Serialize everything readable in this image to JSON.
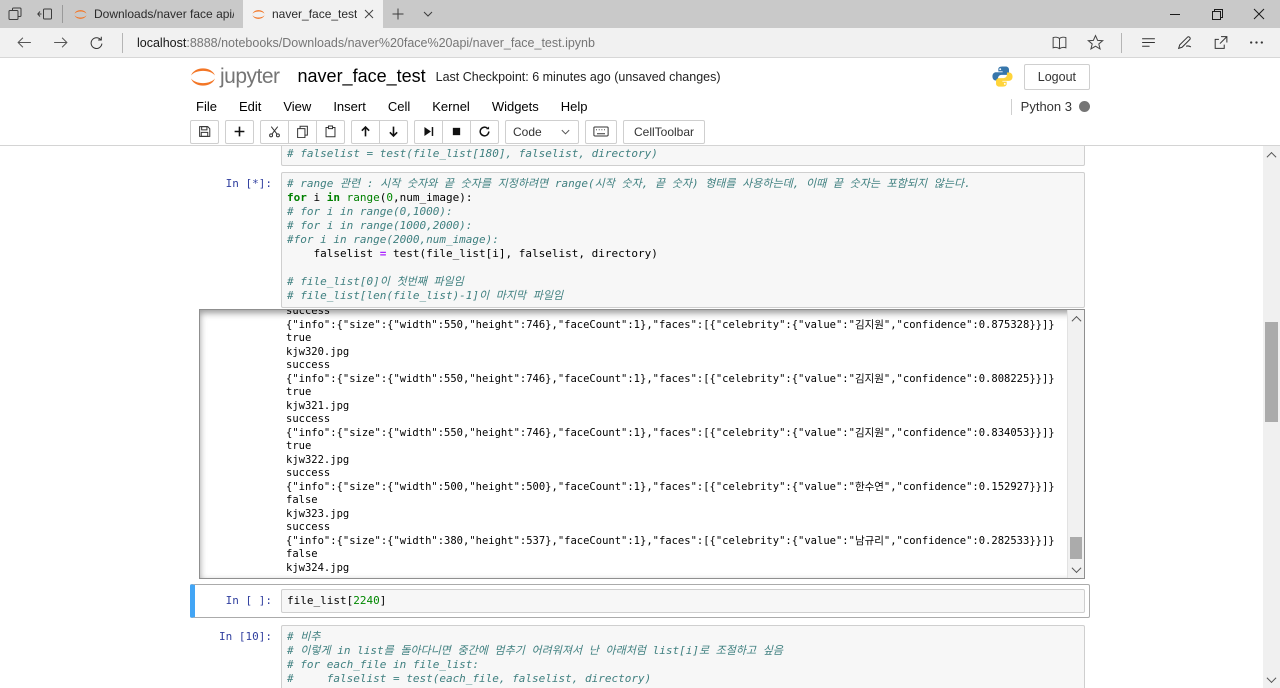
{
  "browser": {
    "tabs": [
      {
        "label": "Downloads/naver face api/",
        "active": false
      },
      {
        "label": "naver_face_test",
        "active": true
      }
    ],
    "url": {
      "host": "localhost",
      "path": ":8888/notebooks/Downloads/naver%20face%20api/naver_face_test.ipynb"
    }
  },
  "header": {
    "logo_text": "jupyter",
    "title": "naver_face_test",
    "checkpoint": "Last Checkpoint: 6 minutes ago (unsaved changes)",
    "logout_label": "Logout",
    "kernel_name": "Python 3",
    "kernel_status": "busy"
  },
  "menu": {
    "items": [
      "File",
      "Edit",
      "View",
      "Insert",
      "Cell",
      "Kernel",
      "Widgets",
      "Help"
    ]
  },
  "toolbar": {
    "cell_type_selected": "Code",
    "celltoolbar_label": "CellToolbar",
    "icons": [
      "save-icon",
      "add-cell-icon",
      "cut-icon",
      "copy-icon",
      "paste-icon",
      "move-up-icon",
      "move-down-icon",
      "run-icon",
      "stop-icon",
      "restart-icon",
      "keyboard-icon"
    ]
  },
  "colors": {
    "jupyter_orange": "#f37626",
    "prompt_blue": "#303f9f",
    "selected_cell_blue": "#42a5f5",
    "comment_teal": "#408080",
    "keyword_green": "#008000",
    "number_green": "#008800",
    "operator_purple": "#aa22ff"
  },
  "cells": [
    {
      "prompt": "",
      "source": [
        [
          {
            "t": "# falselist = test(file_list[180], falselist, directory)",
            "c": "com"
          }
        ]
      ]
    },
    {
      "prompt": "In [*]:",
      "source": [
        [
          {
            "t": "# range 관련 : 시작 숫자와 끝 숫자를 지정하려면 range(시작 숫자, 끝 숫자) 형태를 사용하는데, 이때 끝 숫자는 포함되지 않는다.",
            "c": "com"
          }
        ],
        [
          {
            "t": "for",
            "c": "kw"
          },
          {
            "t": " i "
          },
          {
            "t": "in",
            "c": "kw"
          },
          {
            "t": " "
          },
          {
            "t": "range",
            "c": "bi"
          },
          {
            "t": "("
          },
          {
            "t": "0",
            "c": "num"
          },
          {
            "t": ",num_image):"
          }
        ],
        [
          {
            "t": "# for i in range(0,1000):",
            "c": "com"
          }
        ],
        [
          {
            "t": "# for i in range(1000,2000):",
            "c": "com"
          }
        ],
        [
          {
            "t": "#for i in range(2000,num_image):",
            "c": "com"
          }
        ],
        [
          {
            "t": "    falselist "
          },
          {
            "t": "=",
            "c": "op"
          },
          {
            "t": " test(file_list[i], falselist, directory)"
          }
        ],
        [
          {
            "t": ""
          }
        ],
        [
          {
            "t": "# file_list[0]이 첫번째 파일임",
            "c": "com"
          }
        ],
        [
          {
            "t": "# file_list[len(file_list)-1]이 마지막 파일임",
            "c": "com"
          }
        ]
      ],
      "output": {
        "scrolled": true,
        "lines": [
          "success",
          "{\"info\":{\"size\":{\"width\":550,\"height\":746},\"faceCount\":1},\"faces\":[{\"celebrity\":{\"value\":\"김지원\",\"confidence\":0.875328}}]}",
          "true",
          "kjw320.jpg",
          "success",
          "{\"info\":{\"size\":{\"width\":550,\"height\":746},\"faceCount\":1},\"faces\":[{\"celebrity\":{\"value\":\"김지원\",\"confidence\":0.808225}}]}",
          "true",
          "kjw321.jpg",
          "success",
          "{\"info\":{\"size\":{\"width\":550,\"height\":746},\"faceCount\":1},\"faces\":[{\"celebrity\":{\"value\":\"김지원\",\"confidence\":0.834053}}]}",
          "true",
          "kjw322.jpg",
          "success",
          "{\"info\":{\"size\":{\"width\":500,\"height\":500},\"faceCount\":1},\"faces\":[{\"celebrity\":{\"value\":\"한수연\",\"confidence\":0.152927}}]}",
          "false",
          "kjw323.jpg",
          "success",
          "{\"info\":{\"size\":{\"width\":380,\"height\":537},\"faceCount\":1},\"faces\":[{\"celebrity\":{\"value\":\"남규리\",\"confidence\":0.282533}}]}",
          "false",
          "kjw324.jpg"
        ]
      }
    },
    {
      "prompt": "In [ ]:",
      "selected": true,
      "source": [
        [
          {
            "t": "file_list["
          },
          {
            "t": "2240",
            "c": "num"
          },
          {
            "t": "]"
          }
        ]
      ]
    },
    {
      "prompt": "In [10]:",
      "source": [
        [
          {
            "t": "# 비추",
            "c": "com"
          }
        ],
        [
          {
            "t": "# 이렇게 in list를 돌아다니면 중간에 멈추기 어려워져서 난 아래처럼 list[i]로 조절하고 싶음",
            "c": "com"
          }
        ],
        [
          {
            "t": "# for each_file in file_list:",
            "c": "com"
          }
        ],
        [
          {
            "t": "#     falselist = test(each_file, falselist, directory)",
            "c": "com"
          }
        ]
      ]
    }
  ]
}
